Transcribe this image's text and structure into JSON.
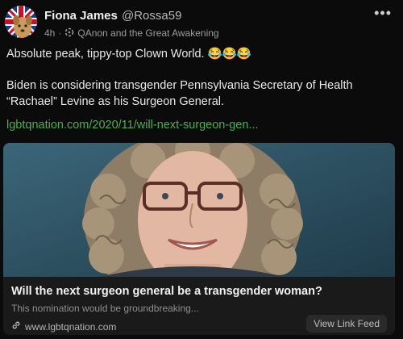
{
  "post": {
    "author": {
      "name": "Fiona James",
      "handle": "@Rossa59"
    },
    "meta": {
      "time": "4h",
      "separator": "·",
      "group": "QAnon and the Great Awakening"
    },
    "text_line1": "Absolute peak, tippy-top Clown World. 😂😂😂",
    "text_line2": "Biden is considering transgender Pennsylvania Secretary of Health “Rachael” Levine as his Surgeon General.",
    "link": "lgbtqnation.com/2020/11/will-next-surgeon-gen..."
  },
  "card": {
    "title": "Will the next surgeon general be a transgender woman?",
    "description": "This nomination would be groundbreaking...",
    "domain": "www.lgbtqnation.com",
    "button": "View Link Feed"
  },
  "icons": {
    "more": "more-options-icon",
    "group": "group-icon",
    "link": "link-icon"
  },
  "colors": {
    "background": "#0b0b0b",
    "link": "#4caf50",
    "card": "#1a1a1a"
  }
}
